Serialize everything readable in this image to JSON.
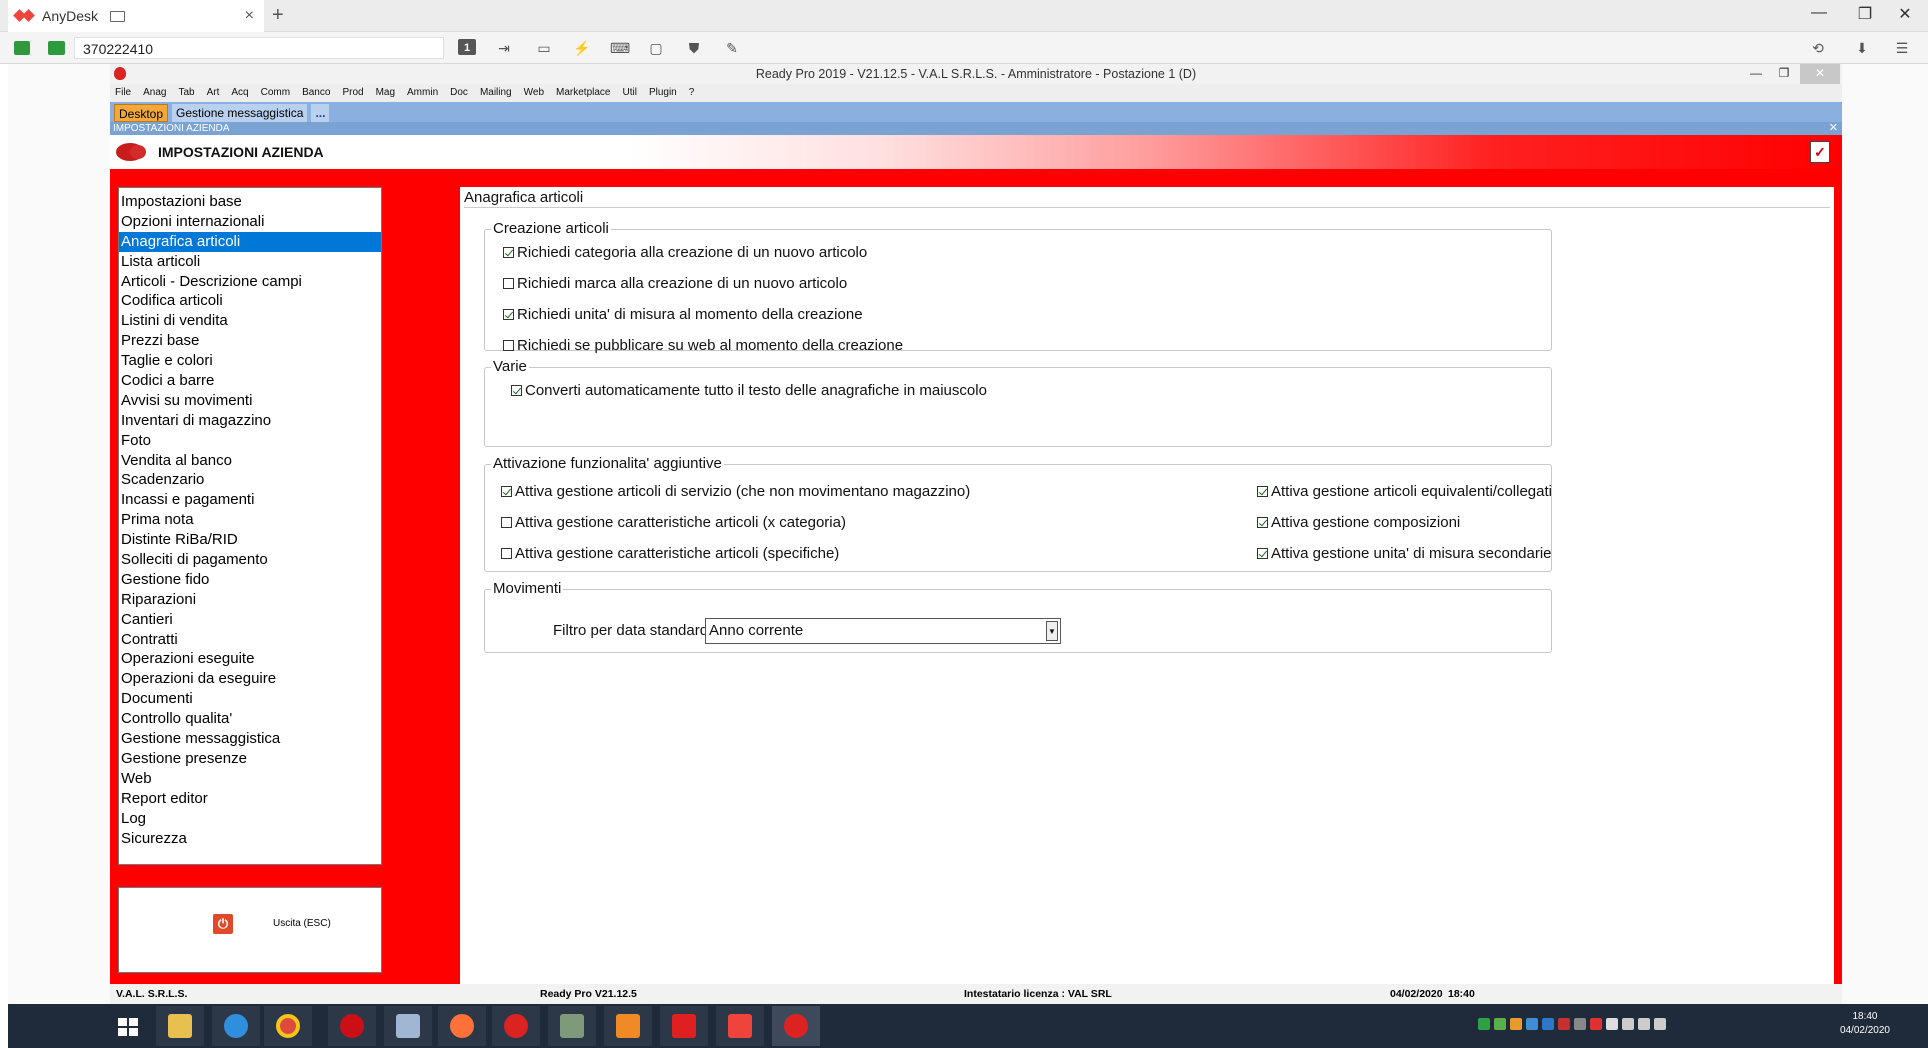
{
  "anydesk": {
    "tab_title": "AnyDesk",
    "address": "370222410"
  },
  "app": {
    "title": "Ready Pro 2019 - V21.12.5 - V.A.L S.R.L.S. - Amministratore - Postazione 1 (D)",
    "menu": [
      "File",
      "Anag",
      "Tab",
      "Art",
      "Acq",
      "Comm",
      "Banco",
      "Prod",
      "Mag",
      "Ammin",
      "Doc",
      "Mailing",
      "Web",
      "Marketplace",
      "Util",
      "Plugin",
      "?"
    ],
    "tabs": {
      "desktop": "Desktop",
      "messaggistica": "Gestione messaggistica",
      "more": "..."
    },
    "subwindow_title": "IMPOSTAZIONI AZIENDA",
    "header_title": "IMPOSTAZIONI AZIENDA",
    "nav": [
      "Impostazioni base",
      "Opzioni internazionali",
      "Anagrafica articoli",
      "Lista articoli",
      "Articoli - Descrizione campi",
      "Codifica articoli",
      "Listini di vendita",
      "Prezzi base",
      "Taglie e colori",
      "Codici a barre",
      "Avvisi su movimenti",
      "Inventari di magazzino",
      "Foto",
      "Vendita al banco",
      "Scadenzario",
      "Incassi e pagamenti",
      "Prima nota",
      "Distinte RiBa/RID",
      "Solleciti di pagamento",
      "Gestione fido",
      "Riparazioni",
      "Cantieri",
      "Contratti",
      "Operazioni eseguite",
      "Operazioni da eseguire",
      "Documenti",
      "Controllo qualita'",
      "Gestione messaggistica",
      "Gestione presenze",
      "Web",
      "Report editor",
      "Log",
      "Sicurezza"
    ],
    "nav_selected_index": 2,
    "exit_label": "Uscita (ESC)",
    "content": {
      "title": "Anagrafica articoli",
      "creazione": {
        "legend": "Creazione articoli",
        "items": [
          {
            "label": "Richiedi categoria alla creazione di un nuovo articolo",
            "checked": true
          },
          {
            "label": "Richiedi marca alla creazione di un nuovo articolo",
            "checked": false
          },
          {
            "label": "Richiedi unita' di misura al momento della creazione",
            "checked": true
          },
          {
            "label": "Richiedi se pubblicare su web al momento della creazione",
            "checked": false
          }
        ]
      },
      "varie": {
        "legend": "Varie",
        "items": [
          {
            "label": "Converti automaticamente tutto il testo delle anagrafiche in maiuscolo",
            "checked": true
          }
        ]
      },
      "attivazione": {
        "legend": "Attivazione funzionalita' aggiuntive",
        "left": [
          {
            "label": "Attiva gestione articoli di servizio (che non movimentano magazzino)",
            "checked": true
          },
          {
            "label": "Attiva gestione caratteristiche articoli (x categoria)",
            "checked": false
          },
          {
            "label": "Attiva gestione caratteristiche articoli (specifiche)",
            "checked": false
          }
        ],
        "right": [
          {
            "label": "Attiva gestione articoli equivalenti/collegati",
            "checked": true
          },
          {
            "label": "Attiva gestione composizioni",
            "checked": true
          },
          {
            "label": "Attiva gestione unita' di misura secondarie",
            "checked": true
          }
        ]
      },
      "movimenti": {
        "legend": "Movimenti",
        "filter_label": "Filtro per data standard :",
        "filter_value": "Anno corrente"
      }
    },
    "status": {
      "company": "V.A.L. S.R.L.S.",
      "version": "Ready Pro V21.12.5",
      "license": "Intestatario licenza : VAL SRL",
      "date": "04/02/2020",
      "time": "18:40"
    }
  },
  "taskbar": {
    "time": "18:40",
    "date": "04/02/2020"
  }
}
